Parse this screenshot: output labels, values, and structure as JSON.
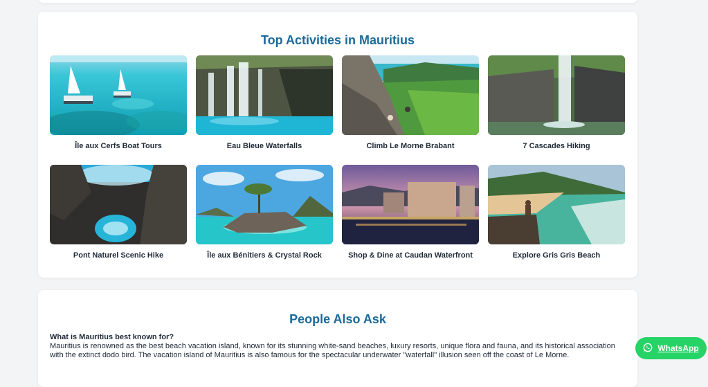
{
  "activities": {
    "title": "Top Activities in Mauritius",
    "items": [
      {
        "label": "Île aux Cerfs Boat Tours",
        "image": "catamaran-lagoon-image"
      },
      {
        "label": "Eau Bleue Waterfalls",
        "image": "waterfall-pool-image"
      },
      {
        "label": "Climb Le Morne Brabant",
        "image": "mountain-view-image"
      },
      {
        "label": "7 Cascades Hiking",
        "image": "cascade-waterfall-image"
      },
      {
        "label": "Pont Naturel Scenic Hike",
        "image": "natural-bridge-image"
      },
      {
        "label": "Île aux Bénitiers & Crystal Rock",
        "image": "crystal-rock-image"
      },
      {
        "label": "Shop & Dine at Caudan Waterfront",
        "image": "waterfront-evening-image"
      },
      {
        "label": "Explore Gris Gris Beach",
        "image": "gris-gris-beach-image"
      }
    ]
  },
  "paa": {
    "title": "People Also Ask",
    "question": "What is Mauritius best known for?",
    "answer": "Mauritius is renowned as the best beach vacation island, known for its stunning white-sand beaches, luxury resorts, unique flora and fauna, and its historical association with the extinct dodo bird. The vacation island of Mauritius is also famous for the spectacular underwater \"waterfall\" illusion seen off the coast of Le Morne."
  },
  "whatsapp": {
    "label": "WhatsApp",
    "icon": "whatsapp-icon",
    "color": "#25d366"
  },
  "colors": {
    "title": "#1a6a9a",
    "background": "#f3f4f6"
  }
}
